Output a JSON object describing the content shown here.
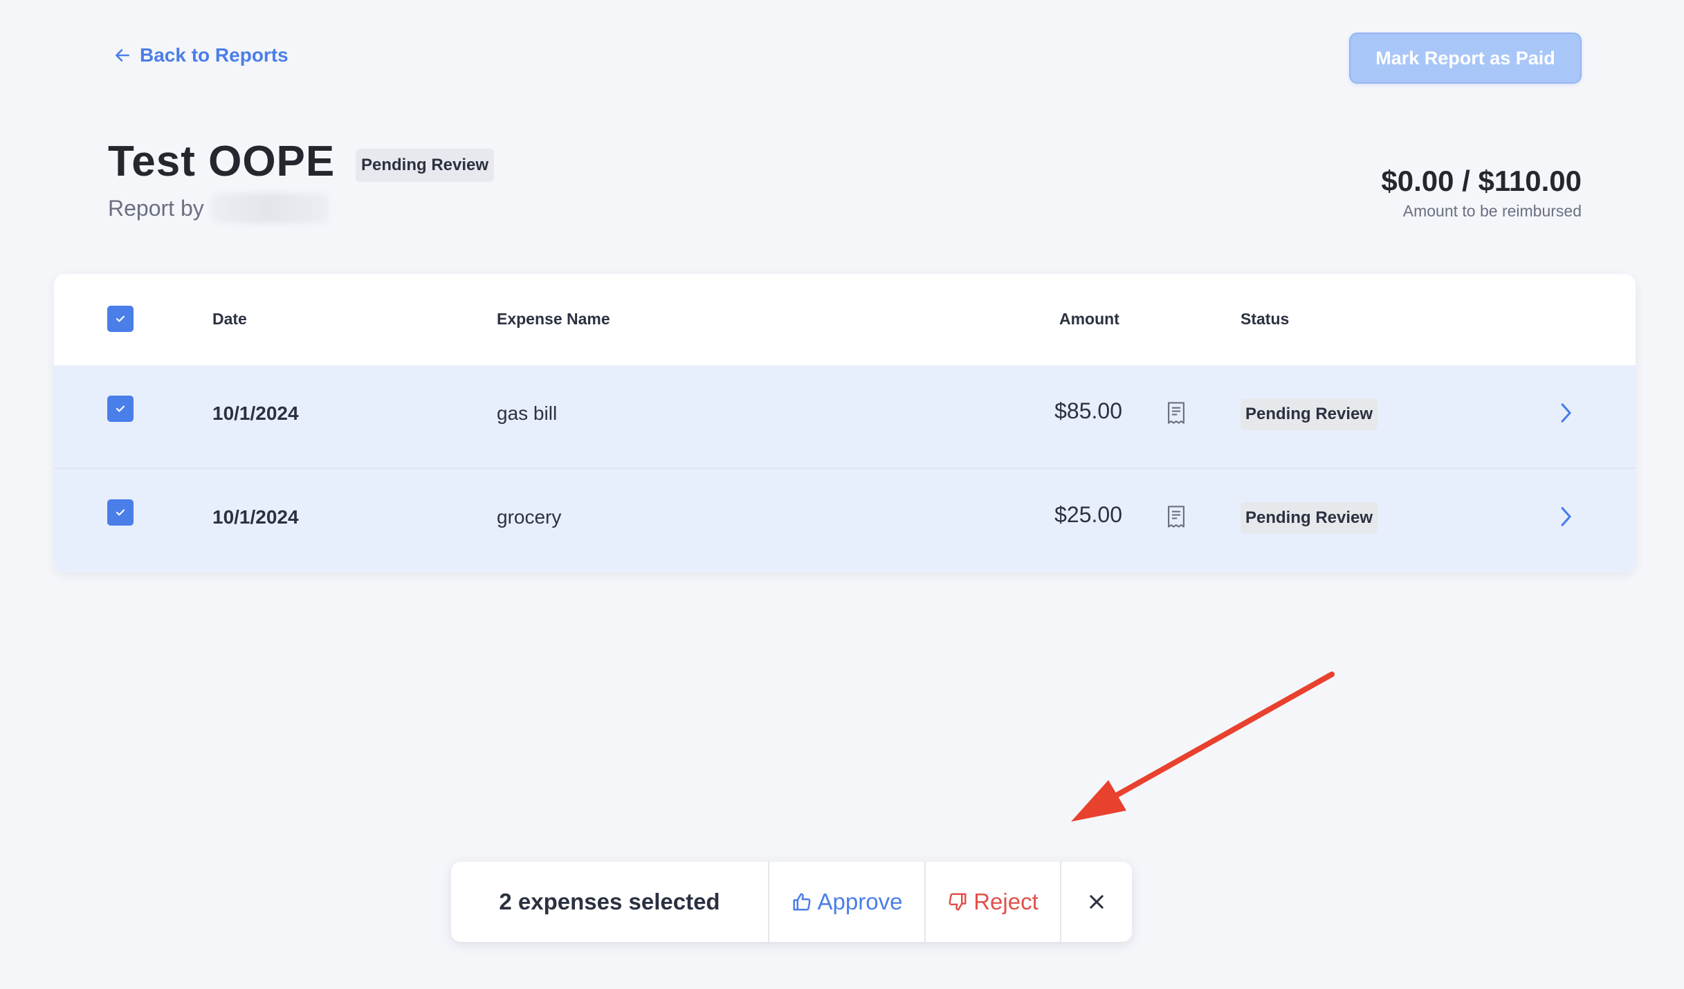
{
  "header": {
    "back_label": "Back to Reports",
    "mark_paid_label": "Mark Report as Paid"
  },
  "report": {
    "title": "Test OOPE",
    "status": "Pending Review",
    "report_by_label": "Report by",
    "amount_summary": "$0.00 / $110.00",
    "amount_caption": "Amount to be reimbursed"
  },
  "table": {
    "columns": {
      "date": "Date",
      "expense_name": "Expense Name",
      "amount": "Amount",
      "status": "Status"
    },
    "rows": [
      {
        "date": "10/1/2024",
        "name": "gas bill",
        "amount": "$85.00",
        "status": "Pending Review",
        "selected": true
      },
      {
        "date": "10/1/2024",
        "name": "grocery",
        "amount": "$25.00",
        "status": "Pending Review",
        "selected": true
      }
    ]
  },
  "action_bar": {
    "selected_text": "2 expenses selected",
    "approve_label": "Approve",
    "reject_label": "Reject"
  },
  "colors": {
    "accent": "#4a7ee8",
    "reject": "#e0504b",
    "annotation_arrow": "#e8412d",
    "row_selected_bg": "#e8effc"
  },
  "icons": {
    "back": "arrow-left-icon",
    "checkbox": "check-icon",
    "receipt": "receipt-icon",
    "row_open": "chevron-right-icon",
    "approve": "thumbs-up-icon",
    "reject": "thumbs-down-icon",
    "close": "close-icon"
  }
}
